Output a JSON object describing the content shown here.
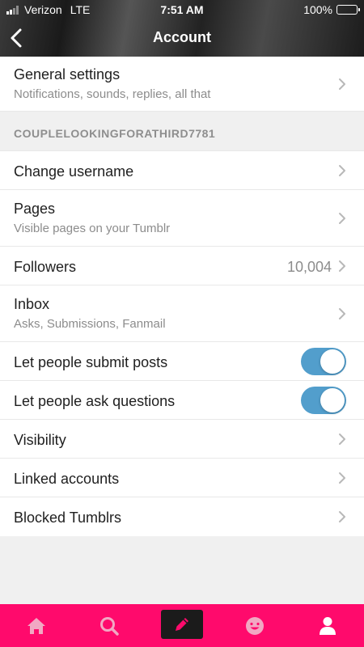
{
  "status_bar": {
    "carrier": "Verizon",
    "network": "LTE",
    "time": "7:51 AM",
    "battery": "100%"
  },
  "nav": {
    "title": "Account"
  },
  "general_settings": {
    "label": "General settings",
    "subtitle": "Notifications, sounds, replies, all that"
  },
  "blog": {
    "name": "COUPLELOOKINGFORATHIRD7781"
  },
  "rows": {
    "change_username": {
      "label": "Change username"
    },
    "pages": {
      "label": "Pages",
      "subtitle": "Visible pages on your Tumblr"
    },
    "followers": {
      "label": "Followers",
      "value": "10,004"
    },
    "inbox": {
      "label": "Inbox",
      "subtitle": "Asks, Submissions, Fanmail"
    },
    "submit_posts": {
      "label": "Let people submit posts",
      "enabled": true
    },
    "ask_questions": {
      "label": "Let people ask questions",
      "enabled": true
    },
    "visibility": {
      "label": "Visibility"
    },
    "linked_accounts": {
      "label": "Linked accounts"
    },
    "blocked": {
      "label": "Blocked Tumblrs"
    }
  },
  "tabbar": {
    "icons": [
      "home-icon",
      "search-icon",
      "compose-icon",
      "activity-icon",
      "account-icon"
    ]
  },
  "colors": {
    "accent": "#ff0a6c",
    "toggle_on": "#529ecc",
    "compose_bg": "#1b1b1b"
  }
}
